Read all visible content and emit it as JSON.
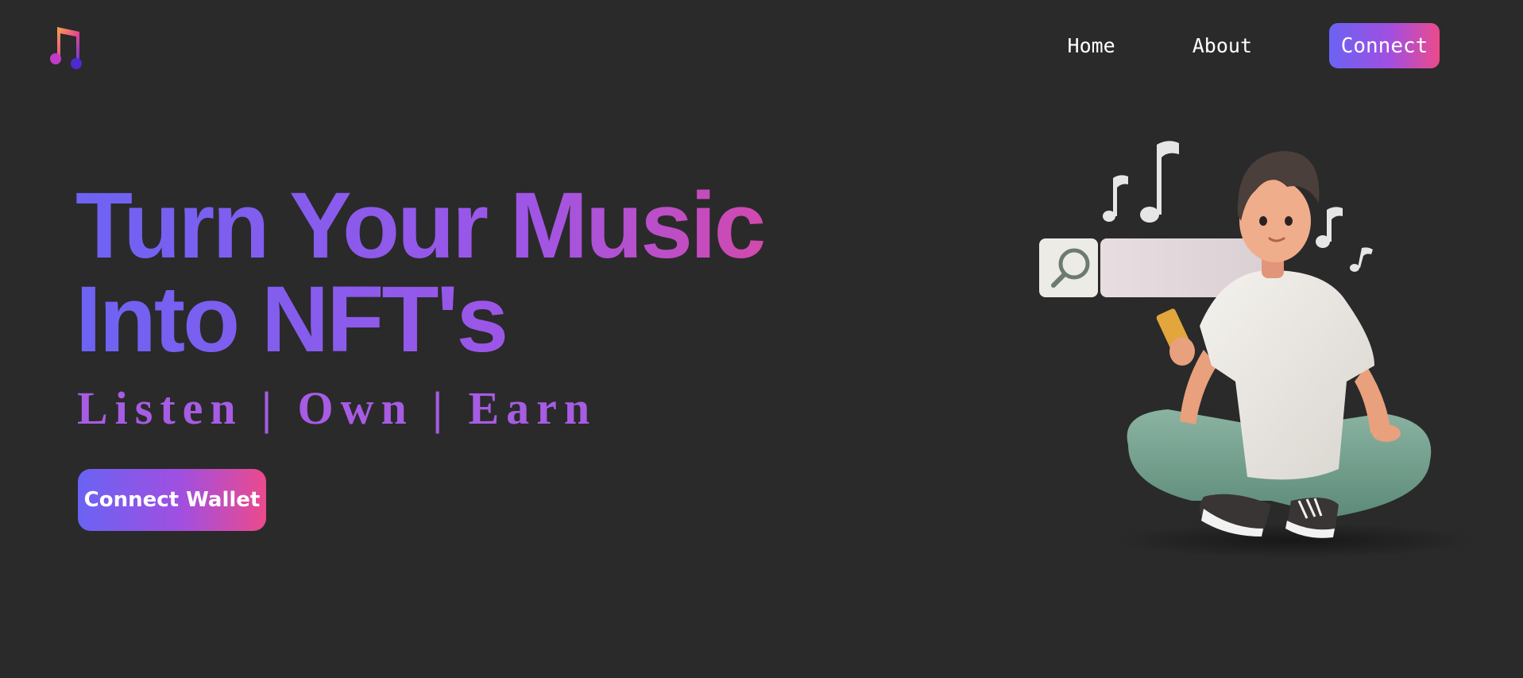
{
  "nav": {
    "home_label": "Home",
    "about_label": "About",
    "connect_label": "Connect"
  },
  "hero": {
    "title_line1": "Turn Your Music",
    "title_line2": "Into NFT's",
    "tagline": "Listen | Own | Earn",
    "cta_label": "Connect Wallet"
  },
  "icons": {
    "logo": "music-note-icon",
    "search": "search-icon"
  },
  "colors": {
    "background": "#2a2a2a",
    "gradient_start": "#6a63f3",
    "gradient_mid": "#a14fe0",
    "gradient_end": "#ec4a8c",
    "tagline": "#a75ce4"
  }
}
